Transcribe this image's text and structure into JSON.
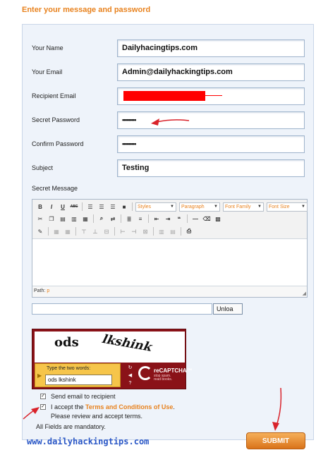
{
  "heading": "Enter your message and password",
  "form": {
    "name_label": "Your Name",
    "name_value": "Dailyhacingtips.com",
    "email_label": "Your Email",
    "email_value": "Admin@dailyhackingtips.com",
    "recipient_label": "Recipient Email",
    "password_label": "Secret Password",
    "password_mask": "•••••••••",
    "confirm_label": "Confirm Password",
    "confirm_mask": "•••••••••",
    "subject_label": "Subject",
    "subject_value": "Testing",
    "message_label": "Secret Message"
  },
  "editor": {
    "bold": "B",
    "italic": "I",
    "underline": "U",
    "strike": "ABC",
    "styles": "Styles",
    "paragraph": "Paragraph",
    "font_family": "Font Family",
    "font_size": "Font Size",
    "path_label": "Path:",
    "path_value": "p"
  },
  "upload_button": "Unloa",
  "captcha": {
    "word1": "ods",
    "word2": "lkshink",
    "hint": "Type the two words:",
    "answer": "ods lkshink",
    "brand": "reCAPTCHA™",
    "tagline1": "stop spam.",
    "tagline2": "read books."
  },
  "options": {
    "send_email": "Send email to recipient",
    "accept_prefix": "I accept the ",
    "terms_link": "Terms and Conditions of Use",
    "accept_suffix": ".",
    "review": "Please review and accept terms.",
    "mandatory": "All Fields are mandatory."
  },
  "watermark": "www.dailyhackingtips.com",
  "submit": "SUBMIT",
  "colors": {
    "accent": "#e8821e",
    "annotation": "#d9232b",
    "watermark": "#2a57c6"
  }
}
